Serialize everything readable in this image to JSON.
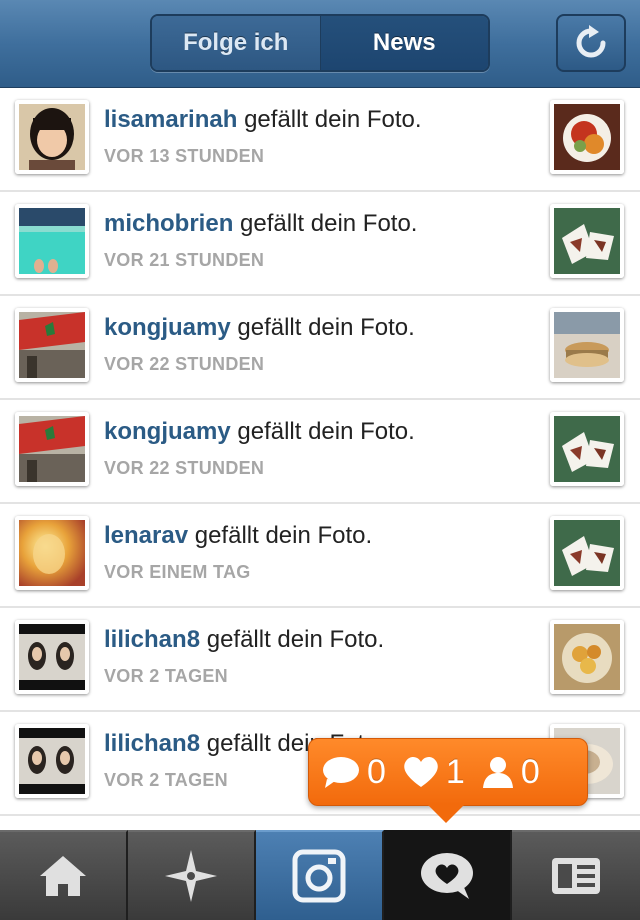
{
  "header": {
    "tabs": [
      {
        "label": "Folge ich",
        "selected": false
      },
      {
        "label": "News",
        "selected": true
      }
    ],
    "refresh_icon": "refresh-icon"
  },
  "feed": {
    "items": [
      {
        "user": "lisamarinah",
        "action": "gefällt dein Foto.",
        "time": "VOR 13 STUNDEN"
      },
      {
        "user": "michobrien",
        "action": "gefällt dein Foto.",
        "time": "VOR 21 STUNDEN"
      },
      {
        "user": "kongjuamy",
        "action": "gefällt dein Foto.",
        "time": "VOR 22 STUNDEN"
      },
      {
        "user": "kongjuamy",
        "action": "gefällt dein Foto.",
        "time": "VOR 22 STUNDEN"
      },
      {
        "user": "lenarav",
        "action": "gefällt dein Foto.",
        "time": "VOR EINEM TAG"
      },
      {
        "user": "lilichan8",
        "action": "gefällt dein Foto.",
        "time": "VOR 2 TAGEN"
      },
      {
        "user": "lilichan8",
        "action": "gefällt dein Foto.",
        "time": "VOR 2 TAGEN"
      }
    ]
  },
  "notifications": {
    "comments": "0",
    "likes": "1",
    "followers": "0"
  },
  "tabbar": {
    "items": [
      {
        "icon": "home-icon"
      },
      {
        "icon": "explore-icon"
      },
      {
        "icon": "camera-icon"
      },
      {
        "icon": "news-icon",
        "active": true
      },
      {
        "icon": "profile-icon"
      }
    ]
  },
  "colors": {
    "header": "#3f6f9d",
    "username": "#2b5b85",
    "timestamp": "#a6a6a6",
    "notification": "#f26a0c"
  }
}
